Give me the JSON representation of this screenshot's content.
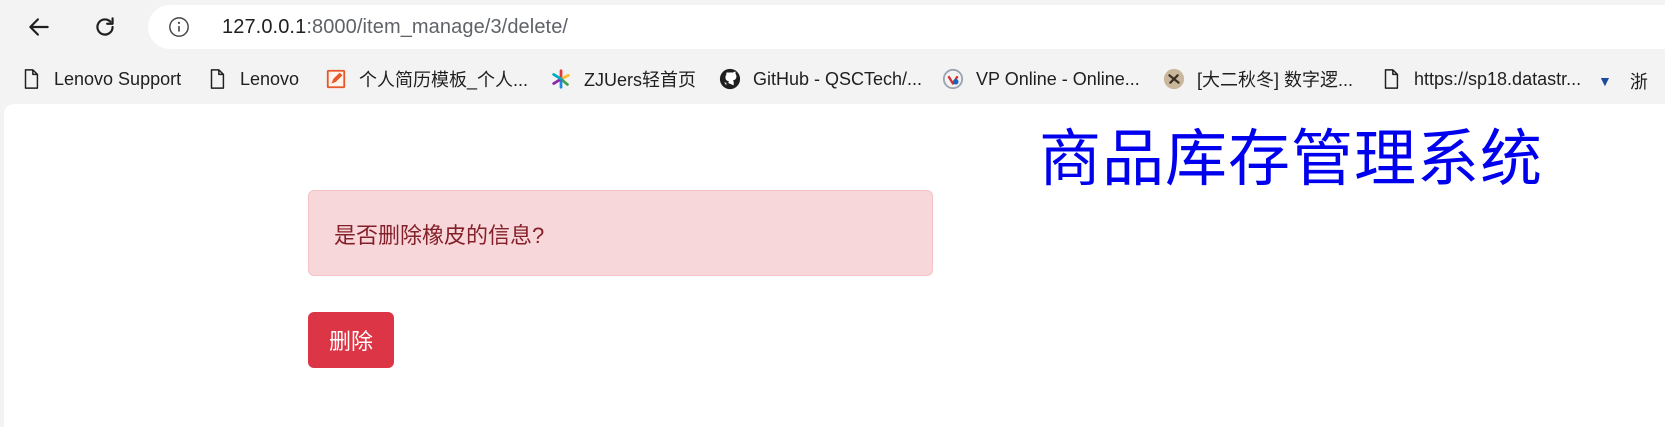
{
  "browser": {
    "url_host": "127.0.0.1",
    "url_rest": ":8000/item_manage/3/delete/",
    "back_icon": "arrow-left-icon",
    "reload_icon": "reload-icon",
    "info_icon": "info-icon"
  },
  "bookmarks": [
    {
      "label": "Lenovo Support",
      "icon": "page-icon"
    },
    {
      "label": "Lenovo",
      "icon": "page-icon"
    },
    {
      "label": "个人简历模板_个人...",
      "icon": "resume-pencil-icon"
    },
    {
      "label": "ZJUers轻首页",
      "icon": "pinwheel-icon"
    },
    {
      "label": "GitHub - QSCTech/...",
      "icon": "github-icon"
    },
    {
      "label": "VP Online - Online...",
      "icon": "vp-online-icon"
    },
    {
      "label": "[大二秋冬] 数字逻...",
      "icon": "avatar-icon"
    },
    {
      "label": "https://sp18.datastr...",
      "icon": "page-icon"
    }
  ],
  "bookmark_overflow": {
    "label": "浙"
  },
  "page": {
    "title": "商品库存管理系统",
    "alert_text": "是否删除橡皮的信息?",
    "delete_label": "删除"
  },
  "colors": {
    "title": "#0000ee",
    "alert_bg": "#f8d7da",
    "alert_text": "#842029",
    "danger": "#dc3545"
  }
}
